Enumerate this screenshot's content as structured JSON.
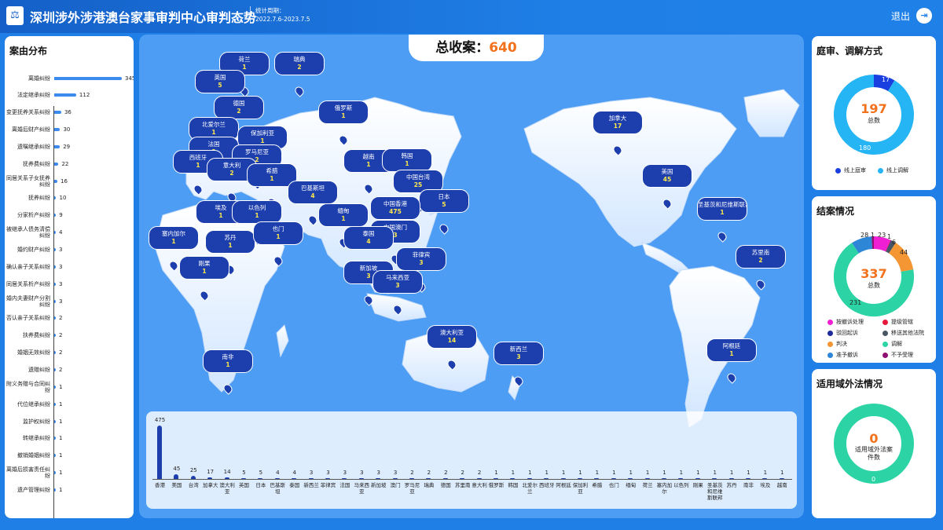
{
  "header": {
    "logo": "⚖",
    "title": "深圳涉外涉港澳台家事审判中心审判态势",
    "period_label": "统计周期：",
    "period_value": "2022.7.6-2023.7.5",
    "logout_label": "退出",
    "logout_icon": "logout-icon"
  },
  "left_panel": {
    "title": "案由分布",
    "bar_color": "#3b8bef",
    "max": 345,
    "items": [
      {
        "label": "离婚纠纷",
        "value": 345
      },
      {
        "label": "法定继承纠纷",
        "value": 112
      },
      {
        "label": "变更抚养关系纠纷",
        "value": 36
      },
      {
        "label": "离婚后财产纠纷",
        "value": 30
      },
      {
        "label": "遗嘱继承纠纷",
        "value": 29
      },
      {
        "label": "抚养费纠纷",
        "value": 22
      },
      {
        "label": "同居关系子女抚养纠纷",
        "value": 16
      },
      {
        "label": "抚养纠纷",
        "value": 10
      },
      {
        "label": "分家析产纠纷",
        "value": 9
      },
      {
        "label": "被继承人债务清偿纠纷",
        "value": 4
      },
      {
        "label": "婚约财产纠纷",
        "value": 3
      },
      {
        "label": "确认亲子关系纠纷",
        "value": 3
      },
      {
        "label": "同居关系析产纠纷",
        "value": 3
      },
      {
        "label": "婚内夫妻财产分割纠纷",
        "value": 3
      },
      {
        "label": "否认亲子关系纠纷",
        "value": 2
      },
      {
        "label": "扶养费纠纷",
        "value": 2
      },
      {
        "label": "婚姻无效纠纷",
        "value": 2
      },
      {
        "label": "遗赠纠纷",
        "value": 2
      },
      {
        "label": "附义务赠与合同纠纷",
        "value": 1
      },
      {
        "label": "代位继承纠纷",
        "value": 1
      },
      {
        "label": "监护权纠纷",
        "value": 1
      },
      {
        "label": "转继承纠纷",
        "value": 1
      },
      {
        "label": "撤销婚姻纠纷",
        "value": 1
      },
      {
        "label": "离婚后损害责任纠纷",
        "value": 1
      },
      {
        "label": "遗产管理纠纷",
        "value": 1
      }
    ]
  },
  "map": {
    "total_label": "总收案：",
    "total_value": "640",
    "pins": [
      {
        "name": "荷兰",
        "value": "1"
      },
      {
        "name": "瑞典",
        "value": "2"
      },
      {
        "name": "英国",
        "value": "5"
      },
      {
        "name": "德国",
        "value": "2"
      },
      {
        "name": "俄罗斯",
        "value": "1"
      },
      {
        "name": "北爱尔兰",
        "value": "1"
      },
      {
        "name": "保加利亚",
        "value": "1"
      },
      {
        "name": "法国",
        "value": "3"
      },
      {
        "name": "罗马尼亚",
        "value": "2"
      },
      {
        "name": "西班牙",
        "value": "1"
      },
      {
        "name": "意大利",
        "value": "2"
      },
      {
        "name": "希腊",
        "value": "1"
      },
      {
        "name": "越南",
        "value": "1"
      },
      {
        "name": "韩国",
        "value": "1"
      },
      {
        "name": "中国台湾",
        "value": "25"
      },
      {
        "name": "巴基斯坦",
        "value": "4"
      },
      {
        "name": "日本",
        "value": "5"
      },
      {
        "name": "埃及",
        "value": "1"
      },
      {
        "name": "以色列",
        "value": "1"
      },
      {
        "name": "缅甸",
        "value": "1"
      },
      {
        "name": "中国香港",
        "value": "475"
      },
      {
        "name": "中国澳门",
        "value": "3"
      },
      {
        "name": "塞内加尔",
        "value": "1"
      },
      {
        "name": "苏丹",
        "value": "1"
      },
      {
        "name": "也门",
        "value": "1"
      },
      {
        "name": "泰国",
        "value": "4"
      },
      {
        "name": "菲律宾",
        "value": "3"
      },
      {
        "name": "刚果",
        "value": "1"
      },
      {
        "name": "新加坡",
        "value": "3"
      },
      {
        "name": "马来西亚",
        "value": "3"
      },
      {
        "name": "澳大利亚",
        "value": "14"
      },
      {
        "name": "新西兰",
        "value": "3"
      },
      {
        "name": "南非",
        "value": "1"
      },
      {
        "name": "加拿大",
        "value": "17"
      },
      {
        "name": "美国",
        "value": "45"
      },
      {
        "name": "圣基茨和尼维斯联邦",
        "value": "1"
      },
      {
        "name": "苏里南",
        "value": "2"
      },
      {
        "name": "阿根廷",
        "value": "1"
      }
    ]
  },
  "bar_chart_labels": {
    "note": ""
  },
  "chart_data": [
    {
      "type": "bar",
      "categories": [
        "香港",
        "美国",
        "台湾",
        "加拿大",
        "澳大利亚",
        "英国",
        "日本",
        "巴基斯坦",
        "泰国",
        "新西兰",
        "菲律宾",
        "法国",
        "马来西亚",
        "新加坡",
        "澳门",
        "罗马尼亚",
        "瑞典",
        "德国",
        "苏里南",
        "意大利",
        "俄罗斯",
        "韩国",
        "北爱尔兰",
        "西班牙",
        "阿根廷",
        "保加利亚",
        "希腊",
        "也门",
        "缅甸",
        "荷兰",
        "塞内加尔",
        "以色列",
        "刚果",
        "圣基茨和尼维斯联邦",
        "苏丹",
        "南非",
        "埃及",
        "越南"
      ],
      "values": [
        475,
        45,
        25,
        17,
        14,
        5,
        5,
        4,
        4,
        3,
        3,
        3,
        3,
        3,
        3,
        2,
        2,
        2,
        2,
        2,
        1,
        1,
        1,
        1,
        1,
        1,
        1,
        1,
        1,
        1,
        1,
        1,
        1,
        1,
        1,
        1,
        1,
        1
      ],
      "ylim": [
        0,
        475
      ],
      "title": "",
      "xlabel": "",
      "ylabel": ""
    },
    {
      "type": "pie",
      "title": "庭审、调解方式",
      "center_value": "197",
      "center_label": "总数",
      "series": [
        {
          "name": "线上庭审",
          "value": 17,
          "color": "#1a3fe0"
        },
        {
          "name": "线上调解",
          "value": 180,
          "color": "#25b4f4"
        }
      ]
    },
    {
      "type": "pie",
      "title": "结案情况",
      "center_value": "337",
      "center_label": "总数",
      "series": [
        {
          "name": "按撤诉处理",
          "value": 23,
          "color": "#f01fd4"
        },
        {
          "name": "提级管辖",
          "value": 1,
          "color": "#e8173c"
        },
        {
          "name": "驳回起诉",
          "value": 1,
          "color": "#1f2a9b"
        },
        {
          "name": "移送其他法院",
          "value": 6,
          "color": "#485563"
        },
        {
          "name": "判决",
          "value": 44,
          "color": "#f39633"
        },
        {
          "name": "调解",
          "value": 231,
          "color": "#2bd3a5"
        },
        {
          "name": "准予撤诉",
          "value": 28,
          "color": "#2d86d6"
        },
        {
          "name": "不予受理",
          "value": 3,
          "color": "#8e1070"
        }
      ],
      "labels": [
        "28",
        "1",
        "23",
        "1",
        "6",
        "44",
        "231"
      ]
    },
    {
      "type": "pie",
      "title": "适用域外法情况",
      "center_value": "0",
      "center_label": "适用域外法案件数",
      "series": [
        {
          "name": "",
          "value": 0,
          "color": "#2bd3a5"
        }
      ],
      "labels": [
        "0"
      ]
    }
  ]
}
